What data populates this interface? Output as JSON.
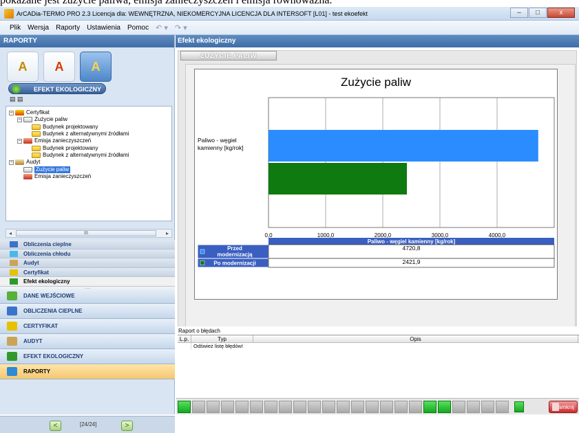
{
  "top_caption": "pokazane jest zużycie paliwa, emisja zanieczyszczeń i emisja równoważna.",
  "window": {
    "title": "ArCADia-TERMO PRO 2.3 Licencja dla: WEWNĘTRZNA, NIEKOMERCYJNA LICENCJA DLA INTERSOFT [L01] - test ekoefekt",
    "min": "–",
    "max": "□",
    "close": "x"
  },
  "menu": {
    "plik": "Plik",
    "wersja": "Wersja",
    "raporty": "Raporty",
    "ustawienia": "Ustawienia",
    "pomoc": "Pomoc"
  },
  "left": {
    "header": "RAPORTY",
    "big_icons": [
      "A",
      "A",
      "A"
    ],
    "eko_button": "EFEKT EKOLOGICZNY",
    "tree": [
      {
        "level": 0,
        "label": "Certyfikat",
        "icon": "cert",
        "expander": "−"
      },
      {
        "level": 1,
        "label": "Zużycie paliw",
        "icon": "fuel",
        "expander": "−"
      },
      {
        "level": 2,
        "label": "Budynek projektowany",
        "icon": "fold",
        "expander": ""
      },
      {
        "level": 2,
        "label": "Budynek z alternatywnymi źródłami",
        "icon": "fold",
        "expander": ""
      },
      {
        "level": 1,
        "label": "Emisja zanieczyszczeń",
        "icon": "emis",
        "expander": "−"
      },
      {
        "level": 2,
        "label": "Budynek projektowany",
        "icon": "fold",
        "expander": ""
      },
      {
        "level": 2,
        "label": "Budynek z alternatywnymi źródłami",
        "icon": "fold",
        "expander": ""
      },
      {
        "level": 0,
        "label": "Audyt",
        "icon": "aud",
        "expander": "−"
      },
      {
        "level": 1,
        "label": "Zużycie paliw",
        "icon": "fuel",
        "expander": "",
        "selected": true
      },
      {
        "level": 1,
        "label": "Emisja zanieczyszczeń",
        "icon": "emis",
        "expander": ""
      }
    ],
    "scroll_label": "III",
    "sublist": [
      {
        "label": "Obliczenia cieplne",
        "color": "#3a73c9"
      },
      {
        "label": "Obliczenia chłodu",
        "color": "#4bb7e8"
      },
      {
        "label": "Audyt",
        "color": "#caa557"
      },
      {
        "label": "Certyfikat",
        "color": "#e7c000"
      },
      {
        "label": "Efekt ekologiczny",
        "color": "#2f9a2a",
        "active": true
      }
    ],
    "mainnav": [
      {
        "label": "DANE WEJŚCIOWE",
        "color": "#57b13a"
      },
      {
        "label": "OBLICZENIA CIEPLNE",
        "color": "#3a73c9"
      },
      {
        "label": "CERTYFIKAT",
        "color": "#e7c000"
      },
      {
        "label": "AUDYT",
        "color": "#caa557"
      },
      {
        "label": "EFEKT EKOLOGICZNY",
        "color": "#2f9a2a"
      },
      {
        "label": "RAPORTY",
        "color": "#2c8bd8",
        "active": true
      }
    ],
    "pager": {
      "prev": "<",
      "next": ">",
      "text": "[24/24]"
    }
  },
  "right": {
    "header": "Efekt ekologiczny",
    "tab": "ZUŻYCIE PALIW"
  },
  "chart_data": {
    "type": "bar",
    "orientation": "horizontal",
    "title": "Zużycie paliw",
    "categories": [
      "Paliwo - węgiel kamienny [kg/rok]"
    ],
    "series": [
      {
        "name": "Przed modernizacją",
        "values": [
          4720.8
        ],
        "color": "#2b8cff"
      },
      {
        "name": "Po modernizacji",
        "values": [
          2421.9
        ],
        "color": "#0f7a0f"
      }
    ],
    "xlim": [
      0,
      5000
    ],
    "ticks": [
      0,
      1000,
      2000,
      3000,
      4000
    ],
    "tick_labels": [
      "0,0",
      "1000,0",
      "2000,0",
      "3000,0",
      "4000,0"
    ],
    "table_header": "Paliwo - węgiel kamienny [kg/rok]",
    "table_values": [
      "4720,8",
      "2421,9"
    ],
    "table_header_color": "#3a5fc0"
  },
  "errors": {
    "title": "Raport o błędach",
    "columns": [
      "L.p.",
      "Typ",
      "Opis"
    ],
    "rows": [
      {
        "lp": "",
        "typ": "Odśwież listę błędów!",
        "opis": ""
      }
    ]
  },
  "bottom": {
    "segments_on": [
      0,
      17,
      18
    ],
    "segments_count": 23,
    "close_label": "Zamknij"
  }
}
